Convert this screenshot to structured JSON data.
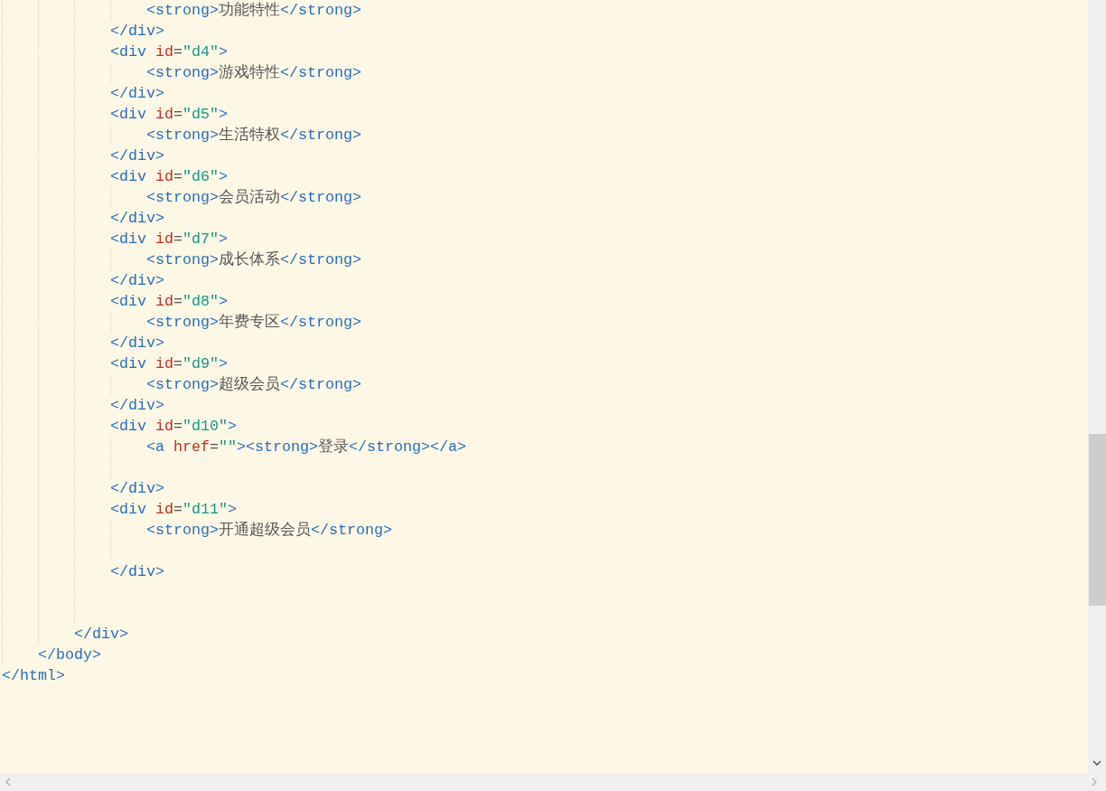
{
  "editor": {
    "lines": [
      {
        "kind": "group",
        "children": [
          {
            "kind": "group",
            "children": [
              {
                "kind": "group",
                "children": [
                  {
                    "kind": "group",
                    "children": [
                      {
                        "kind": "code",
                        "tokens": [
                          {
                            "kind": "tag",
                            "text": "<strong>"
                          },
                          {
                            "kind": "text",
                            "text": "功能特性"
                          },
                          {
                            "kind": "tag",
                            "text": "</strong>"
                          }
                        ]
                      }
                    ]
                  },
                  {
                    "kind": "code",
                    "tokens": [
                      {
                        "kind": "tag",
                        "text": "</div>"
                      }
                    ]
                  },
                  {
                    "kind": "code",
                    "tokens": [
                      {
                        "kind": "tag",
                        "text": "<div "
                      },
                      {
                        "kind": "attr",
                        "text": "id"
                      },
                      {
                        "kind": "punct",
                        "text": "="
                      },
                      {
                        "kind": "value",
                        "text": "\"d4\""
                      },
                      {
                        "kind": "tag",
                        "text": ">"
                      }
                    ],
                    "children": [
                      {
                        "kind": "code",
                        "tokens": [
                          {
                            "kind": "tag",
                            "text": "<strong>"
                          },
                          {
                            "kind": "text",
                            "text": "游戏特性"
                          },
                          {
                            "kind": "tag",
                            "text": "</strong>"
                          }
                        ]
                      }
                    ]
                  },
                  {
                    "kind": "code",
                    "tokens": [
                      {
                        "kind": "tag",
                        "text": "</div>"
                      }
                    ]
                  },
                  {
                    "kind": "code",
                    "tokens": [
                      {
                        "kind": "tag",
                        "text": "<div "
                      },
                      {
                        "kind": "attr",
                        "text": "id"
                      },
                      {
                        "kind": "punct",
                        "text": "="
                      },
                      {
                        "kind": "value",
                        "text": "\"d5\""
                      },
                      {
                        "kind": "tag",
                        "text": ">"
                      }
                    ],
                    "children": [
                      {
                        "kind": "code",
                        "tokens": [
                          {
                            "kind": "tag",
                            "text": "<strong>"
                          },
                          {
                            "kind": "text",
                            "text": "生活特权"
                          },
                          {
                            "kind": "tag",
                            "text": "</strong>"
                          }
                        ]
                      }
                    ]
                  },
                  {
                    "kind": "code",
                    "tokens": [
                      {
                        "kind": "tag",
                        "text": "</div>"
                      }
                    ]
                  },
                  {
                    "kind": "code",
                    "tokens": [
                      {
                        "kind": "tag",
                        "text": "<div "
                      },
                      {
                        "kind": "attr",
                        "text": "id"
                      },
                      {
                        "kind": "punct",
                        "text": "="
                      },
                      {
                        "kind": "value",
                        "text": "\"d6\""
                      },
                      {
                        "kind": "tag",
                        "text": ">"
                      }
                    ],
                    "children": [
                      {
                        "kind": "code",
                        "tokens": [
                          {
                            "kind": "tag",
                            "text": "<strong>"
                          },
                          {
                            "kind": "text",
                            "text": "会员活动"
                          },
                          {
                            "kind": "tag",
                            "text": "</strong>"
                          }
                        ]
                      }
                    ]
                  },
                  {
                    "kind": "code",
                    "tokens": [
                      {
                        "kind": "tag",
                        "text": "</div>"
                      }
                    ]
                  },
                  {
                    "kind": "code",
                    "tokens": [
                      {
                        "kind": "tag",
                        "text": "<div "
                      },
                      {
                        "kind": "attr",
                        "text": "id"
                      },
                      {
                        "kind": "punct",
                        "text": "="
                      },
                      {
                        "kind": "value",
                        "text": "\"d7\""
                      },
                      {
                        "kind": "tag",
                        "text": ">"
                      }
                    ],
                    "children": [
                      {
                        "kind": "code",
                        "tokens": [
                          {
                            "kind": "tag",
                            "text": "<strong>"
                          },
                          {
                            "kind": "text",
                            "text": "成长体系"
                          },
                          {
                            "kind": "tag",
                            "text": "</strong>"
                          }
                        ]
                      }
                    ]
                  },
                  {
                    "kind": "code",
                    "tokens": [
                      {
                        "kind": "tag",
                        "text": "</div>"
                      }
                    ]
                  },
                  {
                    "kind": "code",
                    "tokens": [
                      {
                        "kind": "tag",
                        "text": "<div "
                      },
                      {
                        "kind": "attr",
                        "text": "id"
                      },
                      {
                        "kind": "punct",
                        "text": "="
                      },
                      {
                        "kind": "value",
                        "text": "\"d8\""
                      },
                      {
                        "kind": "tag",
                        "text": ">"
                      }
                    ],
                    "children": [
                      {
                        "kind": "code",
                        "tokens": [
                          {
                            "kind": "tag",
                            "text": "<strong>"
                          },
                          {
                            "kind": "text",
                            "text": "年费专区"
                          },
                          {
                            "kind": "tag",
                            "text": "</strong>"
                          }
                        ]
                      }
                    ]
                  },
                  {
                    "kind": "code",
                    "tokens": [
                      {
                        "kind": "tag",
                        "text": "</div>"
                      }
                    ]
                  },
                  {
                    "kind": "code",
                    "tokens": [
                      {
                        "kind": "tag",
                        "text": "<div "
                      },
                      {
                        "kind": "attr",
                        "text": "id"
                      },
                      {
                        "kind": "punct",
                        "text": "="
                      },
                      {
                        "kind": "value",
                        "text": "\"d9\""
                      },
                      {
                        "kind": "tag",
                        "text": ">"
                      }
                    ],
                    "children": [
                      {
                        "kind": "code",
                        "tokens": [
                          {
                            "kind": "tag",
                            "text": "<strong>"
                          },
                          {
                            "kind": "text",
                            "text": "超级会员"
                          },
                          {
                            "kind": "tag",
                            "text": "</strong>"
                          }
                        ]
                      }
                    ]
                  },
                  {
                    "kind": "code",
                    "tokens": [
                      {
                        "kind": "tag",
                        "text": "</div>"
                      }
                    ]
                  },
                  {
                    "kind": "code",
                    "tokens": [
                      {
                        "kind": "tag",
                        "text": "<div "
                      },
                      {
                        "kind": "attr",
                        "text": "id"
                      },
                      {
                        "kind": "punct",
                        "text": "="
                      },
                      {
                        "kind": "value",
                        "text": "\"d10\""
                      },
                      {
                        "kind": "tag",
                        "text": ">"
                      }
                    ],
                    "children": [
                      {
                        "kind": "code",
                        "tokens": [
                          {
                            "kind": "tag",
                            "text": "<a "
                          },
                          {
                            "kind": "attr",
                            "text": "href"
                          },
                          {
                            "kind": "punct",
                            "text": "="
                          },
                          {
                            "kind": "value",
                            "text": "\"\""
                          },
                          {
                            "kind": "tag",
                            "text": "><strong>"
                          },
                          {
                            "kind": "text",
                            "text": "登录"
                          },
                          {
                            "kind": "tag",
                            "text": "</strong></a>"
                          }
                        ]
                      },
                      {
                        "kind": "blank"
                      }
                    ]
                  },
                  {
                    "kind": "code",
                    "tokens": [
                      {
                        "kind": "tag",
                        "text": "</div>"
                      }
                    ]
                  },
                  {
                    "kind": "code",
                    "tokens": [
                      {
                        "kind": "tag",
                        "text": "<div "
                      },
                      {
                        "kind": "attr",
                        "text": "id"
                      },
                      {
                        "kind": "punct",
                        "text": "="
                      },
                      {
                        "kind": "value",
                        "text": "\"d11\""
                      },
                      {
                        "kind": "tag",
                        "text": ">"
                      }
                    ],
                    "children": [
                      {
                        "kind": "code",
                        "tokens": [
                          {
                            "kind": "tag",
                            "text": "<strong>"
                          },
                          {
                            "kind": "text",
                            "text": "开通超级会员"
                          },
                          {
                            "kind": "tag",
                            "text": "</strong>"
                          }
                        ]
                      },
                      {
                        "kind": "blank"
                      }
                    ]
                  },
                  {
                    "kind": "code",
                    "tokens": [
                      {
                        "kind": "tag",
                        "text": "</div>"
                      }
                    ]
                  },
                  {
                    "kind": "blank"
                  },
                  {
                    "kind": "blank"
                  }
                ]
              },
              {
                "kind": "code",
                "tokens": [
                  {
                    "kind": "tag",
                    "text": "</div>"
                  }
                ]
              }
            ]
          },
          {
            "kind": "code",
            "tokens": [
              {
                "kind": "tag",
                "text": "</body>"
              }
            ]
          }
        ]
      },
      {
        "kind": "code",
        "tokens": [
          {
            "kind": "tag",
            "text": "</html>"
          }
        ]
      }
    ]
  }
}
